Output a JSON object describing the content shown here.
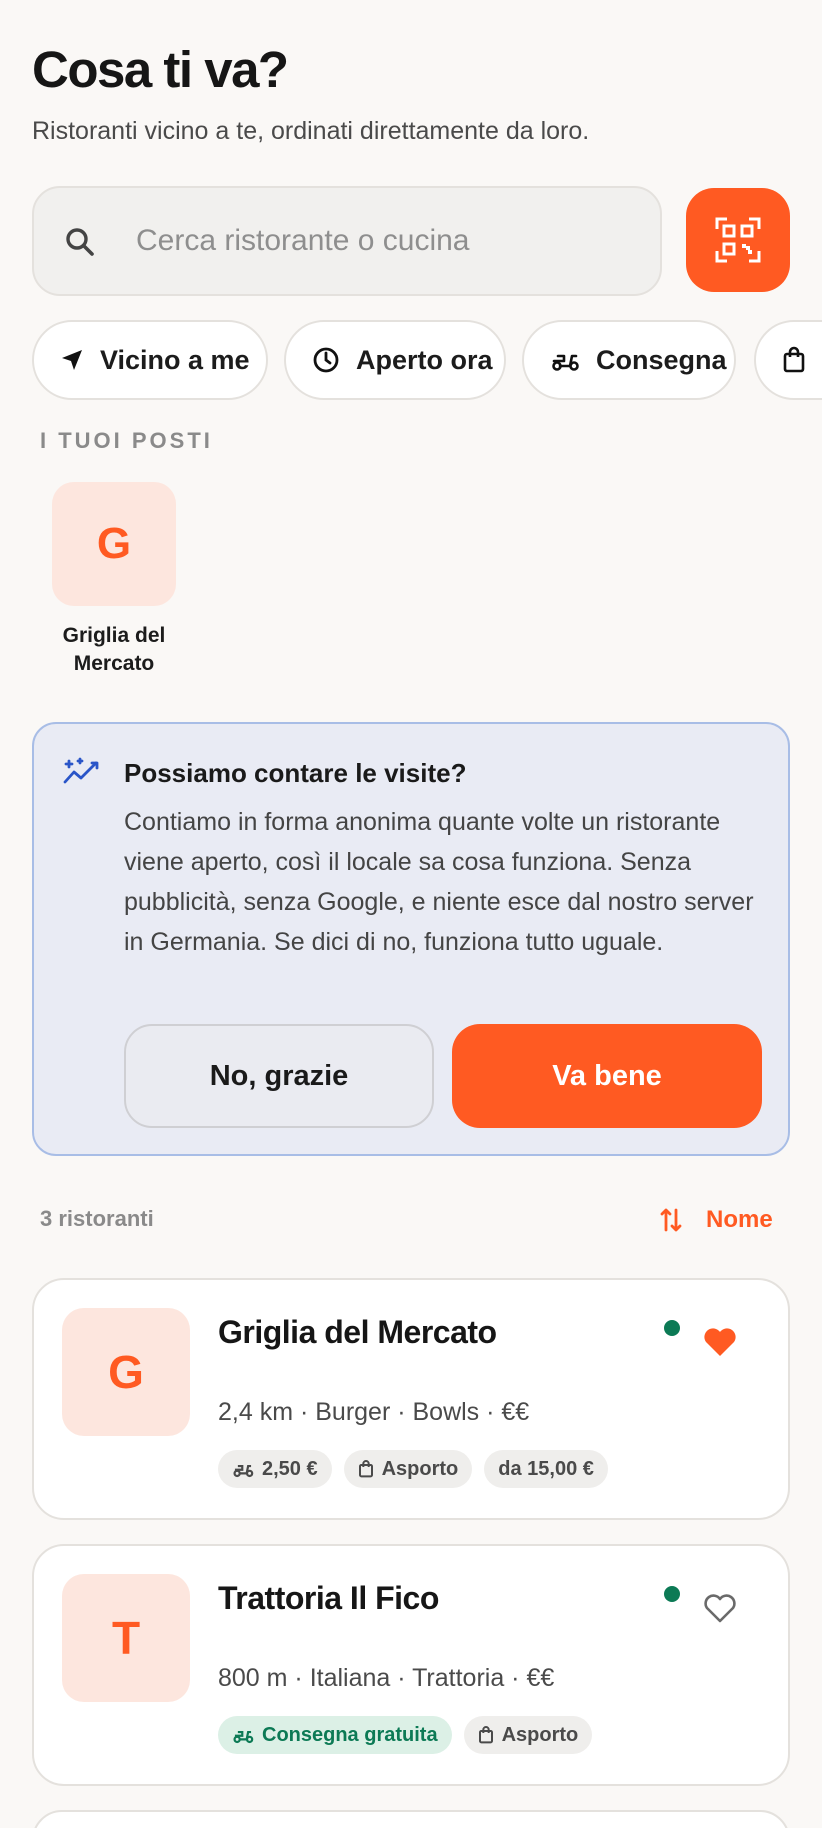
{
  "header": {
    "title": "Cosa ti va?",
    "subtitle": "Ristoranti vicino a te, ordinati direttamente da loro."
  },
  "search": {
    "placeholder": "Cerca ristorante o cucina",
    "value": "",
    "icon": "search-icon",
    "qr_icon": "qr-scan-icon",
    "accent": "#ff5a22"
  },
  "filters": [
    {
      "label": "Vicino a me",
      "icon": "navigation-arrow-icon"
    },
    {
      "label": "Aperto ora",
      "icon": "clock-icon"
    },
    {
      "label": "Consegna",
      "icon": "scooter-icon"
    },
    {
      "label": "",
      "icon": "bag-icon"
    }
  ],
  "my_places": {
    "label": "I TUOI POSTI",
    "items": [
      {
        "initial": "G",
        "name": "Griglia del Mercato"
      }
    ]
  },
  "consent": {
    "icon": "sparkle-chart-icon",
    "title": "Possiamo contare le visite?",
    "text": "Contiamo in forma anonima quante volte un ristorante viene aperto, così il locale sa cosa funziona. Senza pubblicità, senza Google, e niente esce dal nostro server in Germania. Se dici di no, funziona tutto uguale.",
    "decline_label": "No, grazie",
    "accept_label": "Va bene"
  },
  "results": {
    "count_label": "3 ristoranti",
    "sort_label": "Nome",
    "sort_icon": "sort-arrows-icon"
  },
  "restaurants": [
    {
      "initial": "G",
      "name": "Griglia del Mercato",
      "meta": "2,4 km · Burger · Bowls · €€",
      "open": true,
      "favorite": true,
      "tags": [
        {
          "label": "2,50 €",
          "icon": "scooter-icon"
        },
        {
          "label": "Asporto",
          "icon": "bag-icon"
        },
        {
          "label": "da 15,00 €",
          "icon": ""
        }
      ]
    },
    {
      "initial": "T",
      "name": "Trattoria Il Fico",
      "meta": "800 m · Italiana · Trattoria · €€",
      "open": true,
      "favorite": false,
      "tags": [
        {
          "label": "Consegna gratuita",
          "icon": "scooter-icon"
        },
        {
          "label": "Asporto",
          "icon": "bag-icon"
        }
      ]
    }
  ],
  "colors": {
    "accent": "#ff5a22",
    "open_dot": "#0c7a55",
    "consent_bg": "#e9ebf4"
  }
}
